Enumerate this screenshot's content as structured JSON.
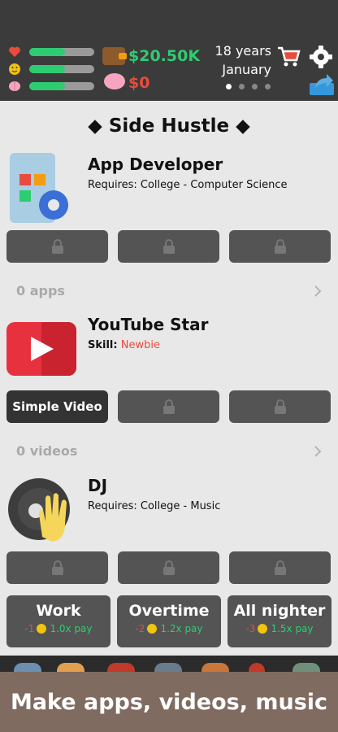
{
  "status": {
    "money": "$20.50K",
    "savings": "$0",
    "age": "18 years",
    "month": "January",
    "bars": [
      {
        "name": "health",
        "level": 0.55,
        "color": "#e74c3c"
      },
      {
        "name": "happiness",
        "level": 0.55,
        "color": "#f1c40f"
      },
      {
        "name": "smarts",
        "level": 0.55,
        "color": "#f6a5c0"
      }
    ]
  },
  "section": {
    "title": "◆ Side Hustle ◆"
  },
  "jobs": [
    {
      "title": "App Developer",
      "requirement_label": "Requires: College - Computer Science",
      "count_label": "0 apps"
    },
    {
      "title": "YouTube Star",
      "skill_key": "Skill:",
      "skill_value": "Newbie",
      "action": "Simple Video",
      "count_label": "0 videos"
    },
    {
      "title": "DJ",
      "requirement_label": "Requires: College - Music"
    }
  ],
  "work": [
    {
      "label": "Work",
      "cost": "-1",
      "pay": "1.0x pay"
    },
    {
      "label": "Overtime",
      "cost": "-2",
      "pay": "1.2x pay"
    },
    {
      "label": "All nighter",
      "cost": "-3",
      "pay": "1.5x pay"
    }
  ],
  "banner": "Make apps, videos, music",
  "colors": {
    "accent_green": "#2ecc71",
    "accent_red": "#e74c3c",
    "topbar": "#3b3b3b",
    "tile": "#545454"
  }
}
